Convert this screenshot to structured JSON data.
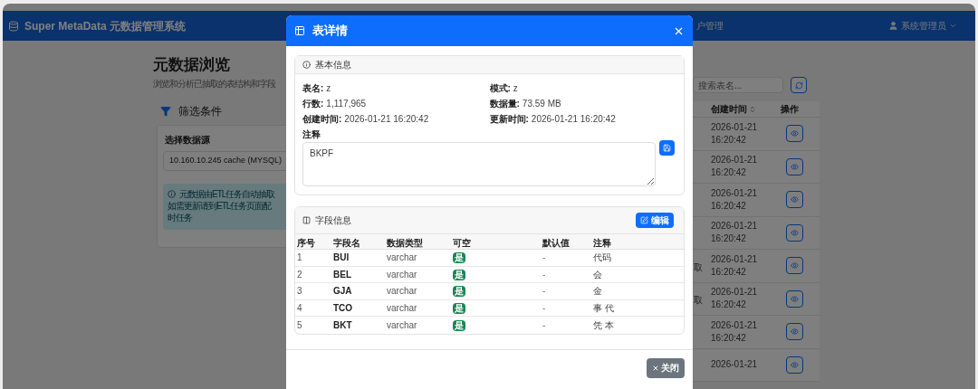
{
  "navbar": {
    "brand": "Super MetaData 元数据管理系统",
    "menu_item": "户管理",
    "user": "系统管理员"
  },
  "page": {
    "title": "元数据浏览",
    "subtitle": "浏览和分析已抽取的表结构和字段",
    "filter": {
      "title": "筛选条件",
      "label": "选择数据源",
      "value": "10.160.10.245 cache (MYSQL)",
      "alert_lines": [
        "元数据由ETL任务自动抽取",
        "如需更新请到ETL任务页面配",
        "时任务"
      ]
    },
    "search": {
      "placeholder": "搜索表名..."
    },
    "table": {
      "columns": [
        "创建时间",
        "操作"
      ],
      "rows": [
        {
          "created": "2026-01-21 16:20:42"
        },
        {
          "created": "2026-01-21 16:20:42"
        },
        {
          "created": "2026-01-21 16:20:42"
        },
        {
          "created": "2026-01-21 16:20:42"
        },
        {
          "column_1": "取",
          "created": "2026-01-21 16:20:42"
        },
        {
          "column_1": "取",
          "created": "2026-01-21 16:20:42"
        },
        {
          "created": "2026-01-21 16:20:42"
        },
        {
          "created": "2026-01-21"
        }
      ]
    }
  },
  "modal": {
    "title": "表详情",
    "basic": {
      "title": "基本信息",
      "fields": [
        {
          "label": "表名:",
          "value": "z"
        },
        {
          "label": "模式:",
          "value": "z"
        },
        {
          "label": "行数:",
          "value": "1,117,965"
        },
        {
          "label": "数据量:",
          "value": "73.59 MB"
        },
        {
          "label": "创建时间:",
          "value": "2026-01-21 16:20:42"
        },
        {
          "label": "更新时间:",
          "value": "2026-01-21 16:20:42"
        }
      ],
      "comment_label": "注释",
      "comment": "BKPF"
    },
    "fields": {
      "title": "字段信息",
      "edit": "编辑",
      "columns": [
        "序号",
        "字段名",
        "数据类型",
        "可空",
        "默认值",
        "注释"
      ],
      "rows": [
        {
          "index": "1",
          "name": "BUI",
          "type": "varchar",
          "nullable": "是",
          "default": "-",
          "comment": "代码"
        },
        {
          "index": "2",
          "name": "BEL",
          "type": "varchar",
          "nullable": "是",
          "default": "-",
          "comment": "会"
        },
        {
          "index": "3",
          "name": "GJA",
          "type": "varchar",
          "nullable": "是",
          "default": "-",
          "comment": "金"
        },
        {
          "index": "4",
          "name": "TCO",
          "type": "varchar",
          "nullable": "是",
          "default": "-",
          "comment": "事 代"
        },
        {
          "index": "5",
          "name": "BKT",
          "type": "varchar",
          "nullable": "是",
          "default": "-",
          "comment": "凭 本"
        }
      ]
    },
    "close": "关闭"
  }
}
